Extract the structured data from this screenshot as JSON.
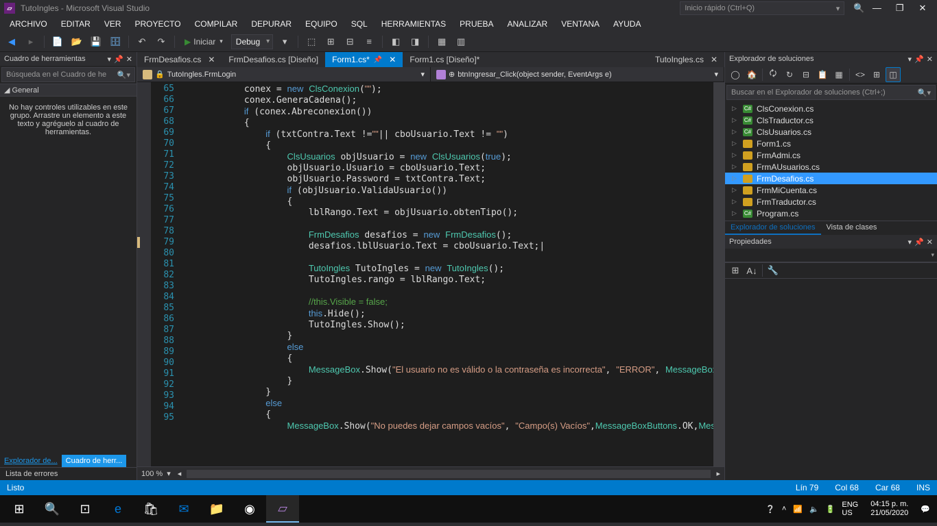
{
  "window": {
    "title": "TutoIngles - Microsoft Visual Studio",
    "quickLaunch": "Inicio rápido (Ctrl+Q)"
  },
  "menu": [
    "ARCHIVO",
    "EDITAR",
    "VER",
    "PROYECTO",
    "COMPILAR",
    "DEPURAR",
    "EQUIPO",
    "SQL",
    "HERRAMIENTAS",
    "PRUEBA",
    "ANALIZAR",
    "VENTANA",
    "AYUDA"
  ],
  "toolbar": {
    "start": "Iniciar",
    "config": "Debug"
  },
  "toolbox": {
    "title": "Cuadro de herramientas",
    "searchPlaceholder": "Búsqueda en el Cuadro de he",
    "group": "General",
    "message": "No hay controles utilizables en este grupo. Arrastre un elemento a este texto y agréguelo al cuadro de herramientas.",
    "tabs": {
      "explorer": "Explorador de...",
      "toolbox": "Cuadro de herr..."
    },
    "errors": "Lista de errores"
  },
  "docTabs": [
    {
      "label": "FrmDesafios.cs",
      "active": false,
      "modified": false,
      "hasClose": true
    },
    {
      "label": "FrmDesafios.cs [Diseño]",
      "active": false
    },
    {
      "label": "Form1.cs*",
      "active": true,
      "pinned": true,
      "hasClose": true
    },
    {
      "label": "Form1.cs [Diseño]*",
      "active": false
    },
    {
      "label": "TutoIngles.cs",
      "active": false,
      "right": true,
      "hasClose": true
    }
  ],
  "nav": {
    "class": "TutoIngles.FrmLogin",
    "method": "btnIngresar_Click(object sender, EventArgs e)"
  },
  "code": {
    "startLine": 65,
    "lines": [
      "            conex = <k>new</k> <t>ClsConexion</t>(<s>\"\"</s>);",
      "            conex.GeneraCadena();",
      "            <k>if</k> (conex.Abreconexion())",
      "            {",
      "                <k>if</k> (txtContra.Text !=<s>\"\"</s>|| cboUsuario.Text != <s>\"\"</s>)",
      "                {",
      "                    <t>ClsUsuarios</t> objUsuario = <k>new</k> <t>ClsUsuarios</t>(<k>true</k>);",
      "                    objUsuario.Usuario = cboUsuario.Text;",
      "                    objUsuario.Password = txtContra.Text;",
      "                    <k>if</k> (objUsuario.ValidaUsuario())",
      "                    {",
      "                        lblRango.Text = objUsuario.obtenTipo();",
      "",
      "                        <t>FrmDesafios</t> desafios = <k>new</k> <t>FrmDesafios</t>();",
      "                        desafios.lblUsuario.Text = cboUsuario.Text;|",
      "",
      "                        <t>TutoIngles</t> TutoIngles = <k>new</k> <t>TutoIngles</t>();",
      "                        TutoIngles.rango = lblRango.Text;",
      "",
      "                        <c>//this.Visible = false;</c>",
      "                        <k>this</k>.Hide();",
      "                        TutoIngles.Show();",
      "                    }",
      "                    <k>else</k>",
      "                    {",
      "                        <t>MessageBox</t>.Show(<s>\"El usuario no es válido o la contraseña es incorrecta\"</s>, <s>\"ERROR\"</s>, <t>MessageBoxButtons</t>.OK, <t>MessageBoxIcon</t>.Error);",
      "                    }",
      "                }",
      "                <k>else</k>",
      "                {",
      "                    <t>MessageBox</t>.Show(<s>\"No puedes dejar campos vacíos\"</s>, <s>\"Campo(s) Vacíos\"</s>,<t>MessageBoxButtons</t>.OK,<t>MessageBoxIcon</t>.Error);"
    ]
  },
  "zoom": "100 %",
  "solution": {
    "title": "Explorador de soluciones",
    "searchPlaceholder": "Buscar en el Explorador de soluciones (Ctrl+;)",
    "items": [
      {
        "label": "ClsConexion.cs",
        "kind": "cs"
      },
      {
        "label": "ClsTraductor.cs",
        "kind": "cs"
      },
      {
        "label": "ClsUsuarios.cs",
        "kind": "cs"
      },
      {
        "label": "Form1.cs",
        "kind": "form"
      },
      {
        "label": "FrmAdmi.cs",
        "kind": "form"
      },
      {
        "label": "FrmAUsuarios.cs",
        "kind": "form"
      },
      {
        "label": "FrmDesafios.cs",
        "kind": "form",
        "selected": true
      },
      {
        "label": "FrmMiCuenta.cs",
        "kind": "form"
      },
      {
        "label": "FrmTraductor.cs",
        "kind": "form"
      },
      {
        "label": "Program.cs",
        "kind": "cs"
      }
    ],
    "tabs": {
      "sol": "Explorador de soluciones",
      "class": "Vista de clases"
    }
  },
  "properties": {
    "title": "Propiedades"
  },
  "status": {
    "ready": "Listo",
    "line": "Lín 79",
    "col": "Col 68",
    "car": "Car 68",
    "ins": "INS"
  },
  "taskbar": {
    "lang": "ENG\nUS",
    "clock": "04:15 p. m.\n21/05/2020"
  }
}
